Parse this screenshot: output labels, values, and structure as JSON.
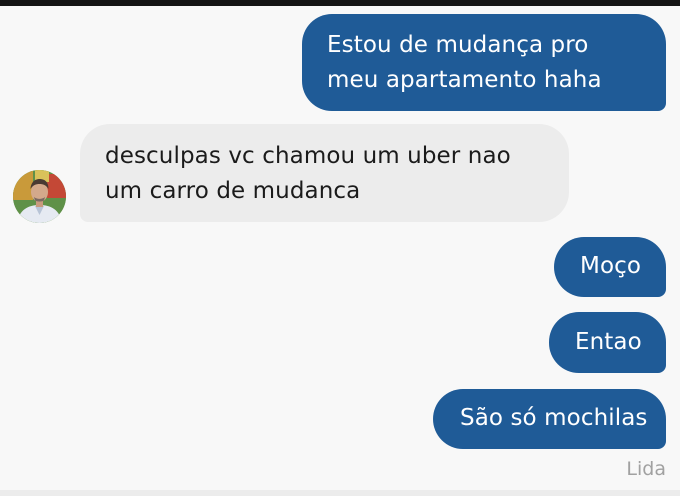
{
  "messages": [
    {
      "direction": "outgoing",
      "text": "Estou de mudança pro meu apartamento haha"
    },
    {
      "direction": "incoming",
      "text": "desculpas vc chamou um uber nao um carro de mudanca"
    },
    {
      "direction": "outgoing",
      "text": "Moço"
    },
    {
      "direction": "outgoing",
      "text": "Entao"
    },
    {
      "direction": "outgoing",
      "text": "São só mochilas"
    }
  ],
  "read_status": "Lida",
  "contact": {
    "avatar_icon": "person-photo-avatar"
  },
  "colors": {
    "outgoing_bubble": "#1f5b97",
    "incoming_bubble": "#ececec",
    "background": "#f8f8f8"
  }
}
